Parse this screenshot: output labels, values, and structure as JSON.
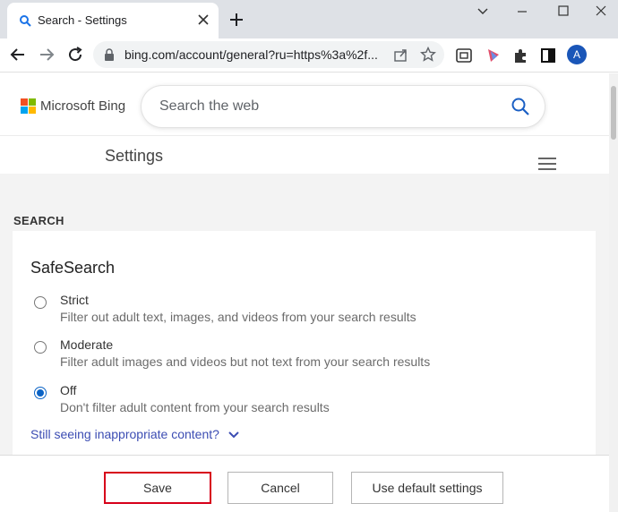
{
  "browser": {
    "tab_title": "Search - Settings",
    "url": "bing.com/account/general?ru=https%3a%2f...",
    "avatar_initial": "A"
  },
  "bing": {
    "brand": "Microsoft Bing",
    "search_placeholder": "Search the web",
    "settings_title": "Settings"
  },
  "section": {
    "heading": "SEARCH",
    "card_title": "SafeSearch",
    "options": [
      {
        "label": "Strict",
        "description": "Filter out adult text, images, and videos from your search results",
        "checked": false
      },
      {
        "label": "Moderate",
        "description": "Filter adult images and videos but not text from your search results",
        "checked": false
      },
      {
        "label": "Off",
        "description": "Don't filter adult content from your search results",
        "checked": true
      }
    ],
    "still_seeing_link": "Still seeing inappropriate content?"
  },
  "footer": {
    "save_label": "Save",
    "cancel_label": "Cancel",
    "default_label": "Use default settings"
  },
  "colors": {
    "accent_blue": "#0b63c5",
    "link_blue": "#3c4db3",
    "highlight_red": "#d7001a"
  }
}
